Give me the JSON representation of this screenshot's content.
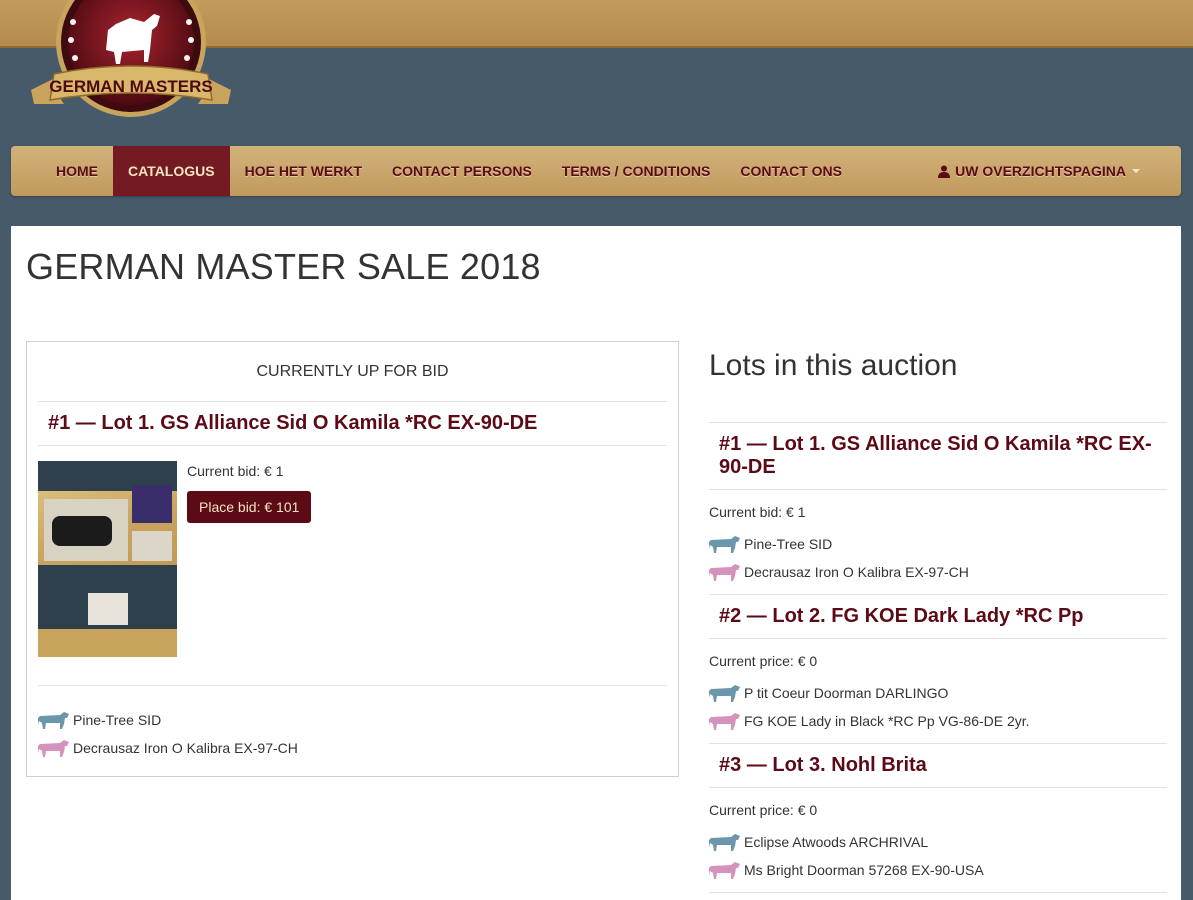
{
  "logo": {
    "text": "GERMAN MASTERS"
  },
  "nav": {
    "items": [
      {
        "label": "HOME",
        "active": false
      },
      {
        "label": "CATALOGUS",
        "active": true
      },
      {
        "label": "HOE HET WERKT",
        "active": false
      },
      {
        "label": "CONTACT PERSONS",
        "active": false
      },
      {
        "label": "TERMS / CONDITIONS",
        "active": false
      },
      {
        "label": "CONTACT ONS",
        "active": false
      }
    ],
    "account_label": "UW OVERZICHTSPAGINA"
  },
  "page": {
    "title": "GERMAN MASTER SALE 2018"
  },
  "current_lot": {
    "heading": "CURRENTLY UP FOR BID",
    "title": "#1 — Lot 1. GS Alliance Sid O Kamila *RC EX-90-DE",
    "current_bid": "Current bid: € 1",
    "place_bid_label": "Place bid: € 101",
    "sire": "Pine-Tree SID",
    "dam": "Decrausaz Iron O Kalibra EX-97-CH"
  },
  "lots": {
    "title": "Lots in this auction",
    "items": [
      {
        "title": "#1 — Lot 1. GS Alliance Sid O Kamila *RC EX-90-DE",
        "price": "Current bid: € 1",
        "sire": "Pine-Tree SID",
        "dam": "Decrausaz Iron O Kalibra EX-97-CH"
      },
      {
        "title": "#2 — Lot 2. FG KOE Dark Lady *RC Pp",
        "price": "Current price: € 0",
        "sire": "P tit Coeur Doorman DARLINGO",
        "dam": "FG KOE Lady in Black *RC Pp VG-86-DE 2yr."
      },
      {
        "title": "#3 — Lot 3. Nohl Brita",
        "price": "Current price: € 0",
        "sire": "Eclipse Atwoods ARCHRIVAL",
        "dam": "Ms Bright Doorman 57268 EX-90-USA"
      }
    ]
  },
  "colors": {
    "background": "#475a6a",
    "gold": "#c39b5d",
    "brand": "#5c0a16",
    "sire_icon": "#6a97ab",
    "dam_icon": "#d592bd"
  },
  "icons": {
    "sire": "cow-icon-blue",
    "dam": "cow-icon-pink",
    "account": "user-icon"
  }
}
